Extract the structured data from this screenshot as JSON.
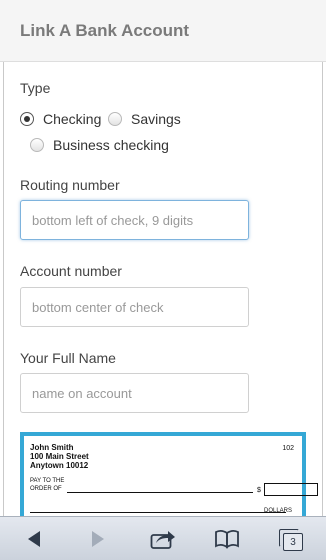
{
  "header": {
    "title": "Link A Bank Account"
  },
  "type": {
    "label": "Type",
    "options": [
      {
        "label": "Checking",
        "selected": true
      },
      {
        "label": "Savings",
        "selected": false
      },
      {
        "label": "Business checking",
        "selected": false
      }
    ]
  },
  "routing": {
    "label": "Routing number",
    "placeholder": "bottom left of check, 9 digits"
  },
  "account": {
    "label": "Account number",
    "placeholder": "bottom center of check"
  },
  "fullname": {
    "label": "Your Full Name",
    "placeholder": "name on account"
  },
  "check": {
    "name": "John Smith",
    "street": "100 Main Street",
    "city": "Anytown 10012",
    "number": "102",
    "pay_to_line1": "PAY TO THE",
    "pay_to_line2": "ORDER OF",
    "dollar_sign": "$",
    "dollars": "DOLLARS"
  },
  "toolbar": {
    "icons": [
      "back-arrow-icon",
      "forward-arrow-icon",
      "share-icon",
      "bookmarks-icon",
      "tabs-icon"
    ],
    "tab_count": "3"
  },
  "colors": {
    "check_border": "#35a8d6",
    "focus_border": "#7eb3dd",
    "header_bg": "#f5f5f5"
  }
}
